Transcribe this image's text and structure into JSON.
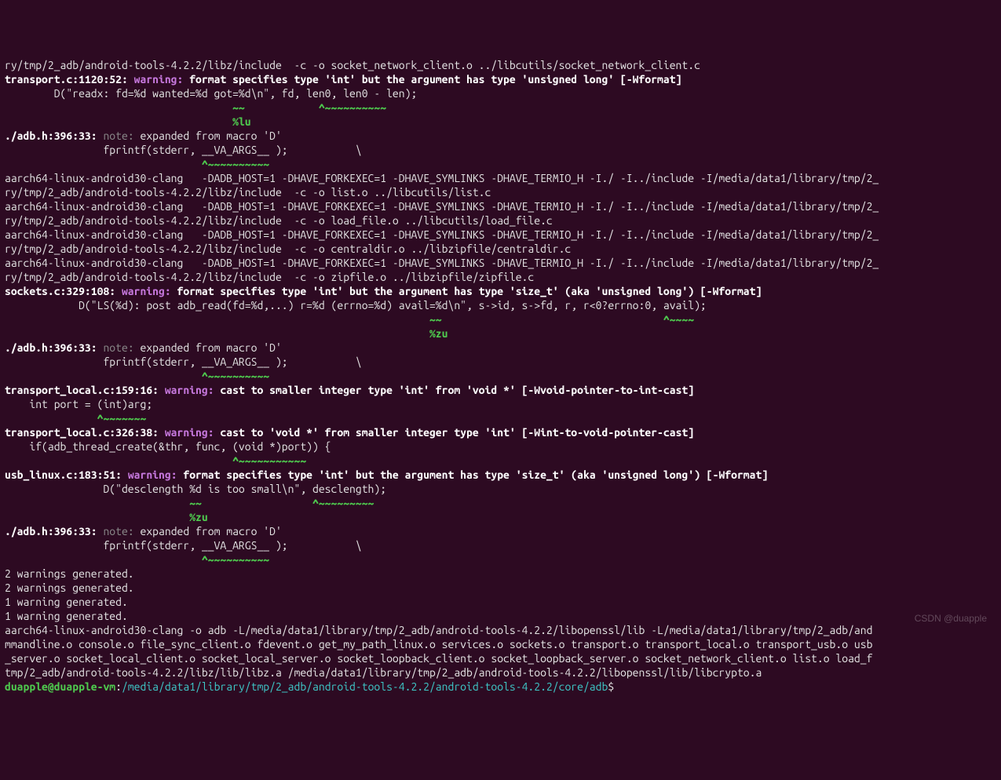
{
  "lines": [
    [
      {
        "cls": "",
        "txt": "ry/tmp/2_adb/android-tools-4.2.2/libz/include  -c -o socket_network_client.o ../libcutils/socket_network_client.c"
      }
    ],
    [
      {
        "cls": "bw",
        "txt": "transport.c:1120:52: "
      },
      {
        "cls": "mag",
        "txt": "warning: "
      },
      {
        "cls": "bw",
        "txt": "format specifies type 'int' but the argument has type 'unsigned long' [-Wformat]"
      }
    ],
    [
      {
        "cls": "",
        "txt": "        D(\"readx: fd=%d wanted=%d got=%d\\n\", fd, len0, len0 - len);"
      }
    ],
    [
      {
        "cls": "grn",
        "txt": "                                     ~~            ^~~~~~~~~~~"
      }
    ],
    [
      {
        "cls": "grn",
        "txt": "                                     %lu"
      }
    ],
    [
      {
        "cls": "bw",
        "txt": "./adb.h:396:33: "
      },
      {
        "cls": "gr",
        "txt": "note: "
      },
      {
        "cls": "",
        "txt": "expanded from macro 'D'"
      }
    ],
    [
      {
        "cls": "",
        "txt": "                fprintf(stderr, __VA_ARGS__ );           \\"
      }
    ],
    [
      {
        "cls": "grn",
        "txt": "                                ^~~~~~~~~~~"
      }
    ],
    [
      {
        "cls": "",
        "txt": "aarch64-linux-android30-clang   -DADB_HOST=1 -DHAVE_FORKEXEC=1 -DHAVE_SYMLINKS -DHAVE_TERMIO_H -I./ -I../include -I/media/data1/library/tmp/2_"
      }
    ],
    [
      {
        "cls": "",
        "txt": "ry/tmp/2_adb/android-tools-4.2.2/libz/include  -c -o list.o ../libcutils/list.c"
      }
    ],
    [
      {
        "cls": "",
        "txt": "aarch64-linux-android30-clang   -DADB_HOST=1 -DHAVE_FORKEXEC=1 -DHAVE_SYMLINKS -DHAVE_TERMIO_H -I./ -I../include -I/media/data1/library/tmp/2_"
      }
    ],
    [
      {
        "cls": "",
        "txt": "ry/tmp/2_adb/android-tools-4.2.2/libz/include  -c -o load_file.o ../libcutils/load_file.c"
      }
    ],
    [
      {
        "cls": "",
        "txt": "aarch64-linux-android30-clang   -DADB_HOST=1 -DHAVE_FORKEXEC=1 -DHAVE_SYMLINKS -DHAVE_TERMIO_H -I./ -I../include -I/media/data1/library/tmp/2_"
      }
    ],
    [
      {
        "cls": "",
        "txt": "ry/tmp/2_adb/android-tools-4.2.2/libz/include  -c -o centraldir.o ../libzipfile/centraldir.c"
      }
    ],
    [
      {
        "cls": "",
        "txt": "aarch64-linux-android30-clang   -DADB_HOST=1 -DHAVE_FORKEXEC=1 -DHAVE_SYMLINKS -DHAVE_TERMIO_H -I./ -I../include -I/media/data1/library/tmp/2_"
      }
    ],
    [
      {
        "cls": "",
        "txt": "ry/tmp/2_adb/android-tools-4.2.2/libz/include  -c -o zipfile.o ../libzipfile/zipfile.c"
      }
    ],
    [
      {
        "cls": "bw",
        "txt": "sockets.c:329:108: "
      },
      {
        "cls": "mag",
        "txt": "warning: "
      },
      {
        "cls": "bw",
        "txt": "format specifies type 'int' but the argument has type 'size_t' (aka 'unsigned long') [-Wformat]"
      }
    ],
    [
      {
        "cls": "",
        "txt": "            D(\"LS(%d): post adb_read(fd=%d,...) r=%d (errno=%d) avail=%d\\n\", s->id, s->fd, r, r<0?errno:0, avail);"
      }
    ],
    [
      {
        "cls": "grn",
        "txt": "                                                                     ~~                                    ^~~~~"
      }
    ],
    [
      {
        "cls": "grn",
        "txt": "                                                                     %zu"
      }
    ],
    [
      {
        "cls": "bw",
        "txt": "./adb.h:396:33: "
      },
      {
        "cls": "gr",
        "txt": "note: "
      },
      {
        "cls": "",
        "txt": "expanded from macro 'D'"
      }
    ],
    [
      {
        "cls": "",
        "txt": "                fprintf(stderr, __VA_ARGS__ );           \\"
      }
    ],
    [
      {
        "cls": "grn",
        "txt": "                                ^~~~~~~~~~~"
      }
    ],
    [
      {
        "cls": "bw",
        "txt": "transport_local.c:159:16: "
      },
      {
        "cls": "mag",
        "txt": "warning: "
      },
      {
        "cls": "bw",
        "txt": "cast to smaller integer type 'int' from 'void *' [-Wvoid-pointer-to-int-cast]"
      }
    ],
    [
      {
        "cls": "",
        "txt": "    int port = (int)arg;"
      }
    ],
    [
      {
        "cls": "grn",
        "txt": "               ^~~~~~~~"
      }
    ],
    [
      {
        "cls": "bw",
        "txt": "transport_local.c:326:38: "
      },
      {
        "cls": "mag",
        "txt": "warning: "
      },
      {
        "cls": "bw",
        "txt": "cast to 'void *' from smaller integer type 'int' [-Wint-to-void-pointer-cast]"
      }
    ],
    [
      {
        "cls": "",
        "txt": "    if(adb_thread_create(&thr, func, (void *)port)) {"
      }
    ],
    [
      {
        "cls": "grn",
        "txt": "                                     ^~~~~~~~~~~~"
      }
    ],
    [
      {
        "cls": "bw",
        "txt": "usb_linux.c:183:51: "
      },
      {
        "cls": "mag",
        "txt": "warning: "
      },
      {
        "cls": "bw",
        "txt": "format specifies type 'int' but the argument has type 'size_t' (aka 'unsigned long') [-Wformat]"
      }
    ],
    [
      {
        "cls": "",
        "txt": "                D(\"desclength %d is too small\\n\", desclength);"
      }
    ],
    [
      {
        "cls": "grn",
        "txt": "                              ~~                  ^~~~~~~~~~"
      }
    ],
    [
      {
        "cls": "grn",
        "txt": "                              %zu"
      }
    ],
    [
      {
        "cls": "bw",
        "txt": "./adb.h:396:33: "
      },
      {
        "cls": "gr",
        "txt": "note: "
      },
      {
        "cls": "",
        "txt": "expanded from macro 'D'"
      }
    ],
    [
      {
        "cls": "",
        "txt": "                fprintf(stderr, __VA_ARGS__ );           \\"
      }
    ],
    [
      {
        "cls": "grn",
        "txt": "                                ^~~~~~~~~~~"
      }
    ],
    [
      {
        "cls": "",
        "txt": "2 warnings generated."
      }
    ],
    [
      {
        "cls": "",
        "txt": "2 warnings generated."
      }
    ],
    [
      {
        "cls": "",
        "txt": "1 warning generated."
      }
    ],
    [
      {
        "cls": "",
        "txt": "1 warning generated."
      }
    ],
    [
      {
        "cls": "",
        "txt": "aarch64-linux-android30-clang -o adb -L/media/data1/library/tmp/2_adb/android-tools-4.2.2/libopenssl/lib -L/media/data1/library/tmp/2_adb/and"
      }
    ],
    [
      {
        "cls": "",
        "txt": "mmandline.o console.o file_sync_client.o fdevent.o get_my_path_linux.o services.o sockets.o transport.o transport_local.o transport_usb.o usb"
      }
    ],
    [
      {
        "cls": "",
        "txt": "_server.o socket_local_client.o socket_local_server.o socket_loopback_client.o socket_loopback_server.o socket_network_client.o list.o load_f"
      }
    ],
    [
      {
        "cls": "",
        "txt": "tmp/2_adb/android-tools-4.2.2/libz/lib/libz.a /media/data1/library/tmp/2_adb/android-tools-4.2.2/libopenssl/lib/libcrypto.a"
      }
    ]
  ],
  "prompt": {
    "user": "duapple@duapple-vm",
    "sep": ":",
    "path": "/media/data1/library/tmp/2_adb/android-tools-4.2.2/android-tools-4.2.2/core/adb",
    "sym": "$"
  },
  "watermark": "CSDN @duapple"
}
